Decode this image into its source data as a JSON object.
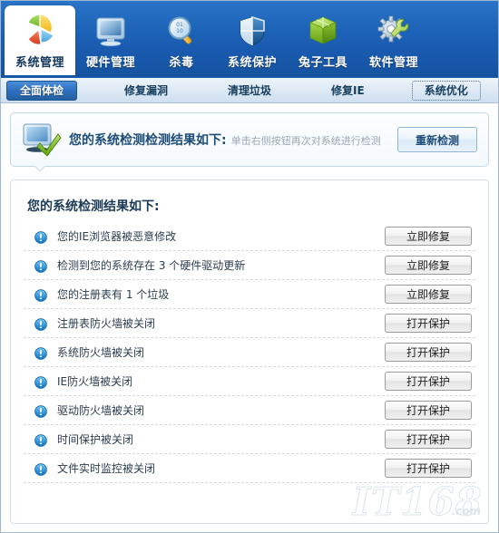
{
  "toolbar": {
    "items": [
      {
        "label": "系统管理",
        "icon": "pie-chart-icon",
        "active": true
      },
      {
        "label": "硬件管理",
        "icon": "monitor-icon",
        "active": false
      },
      {
        "label": "杀毒",
        "icon": "magnifier-icon",
        "active": false
      },
      {
        "label": "系统保护",
        "icon": "shield-icon",
        "active": false
      },
      {
        "label": "兔子工具",
        "icon": "green-box-icon",
        "active": false
      },
      {
        "label": "软件管理",
        "icon": "gear-wrench-icon",
        "active": false
      }
    ]
  },
  "tabs": [
    {
      "label": "全面体检",
      "state": "active"
    },
    {
      "label": "修复漏洞",
      "state": "normal"
    },
    {
      "label": "清理垃圾",
      "state": "normal"
    },
    {
      "label": "修复IE",
      "state": "normal"
    },
    {
      "label": "系统优化",
      "state": "focused"
    }
  ],
  "callout": {
    "icon": "monitor-check-icon",
    "title": "您的系统检测检测结果如下:",
    "subtitle": "单击右侧按钮再次对系统进行检测",
    "button_label": "重新检测"
  },
  "results": {
    "title": "您的系统检测结果如下:",
    "rows": [
      {
        "icon": "alert-info-icon",
        "label": "您的IE浏览器被恶意修改",
        "action": "立即修复"
      },
      {
        "icon": "alert-info-icon",
        "label": "检测到您的系统存在 3 个硬件驱动更新",
        "action": "立即修复"
      },
      {
        "icon": "alert-info-icon",
        "label": "您的注册表有 1 个垃圾",
        "action": "立即修复"
      },
      {
        "icon": "alert-info-icon",
        "label": "注册表防火墙被关闭",
        "action": "打开保护"
      },
      {
        "icon": "alert-info-icon",
        "label": "系统防火墙被关闭",
        "action": "打开保护"
      },
      {
        "icon": "alert-info-icon",
        "label": "IE防火墙被关闭",
        "action": "打开保护"
      },
      {
        "icon": "alert-info-icon",
        "label": "驱动防火墙被关闭",
        "action": "打开保护"
      },
      {
        "icon": "alert-info-icon",
        "label": "时间保护被关闭",
        "action": "打开保护"
      },
      {
        "icon": "alert-info-icon",
        "label": "文件实时监控被关闭",
        "action": "打开保护"
      }
    ]
  },
  "watermark": {
    "text": "IT168",
    "suffix": ".com"
  },
  "colors": {
    "toolbar_blue": "#1d63b8",
    "tab_active_blue": "#2f6fc0",
    "alert_blue": "#1a8fe0",
    "title_text": "#1c4c78",
    "panel_border": "#cfe0ee"
  }
}
